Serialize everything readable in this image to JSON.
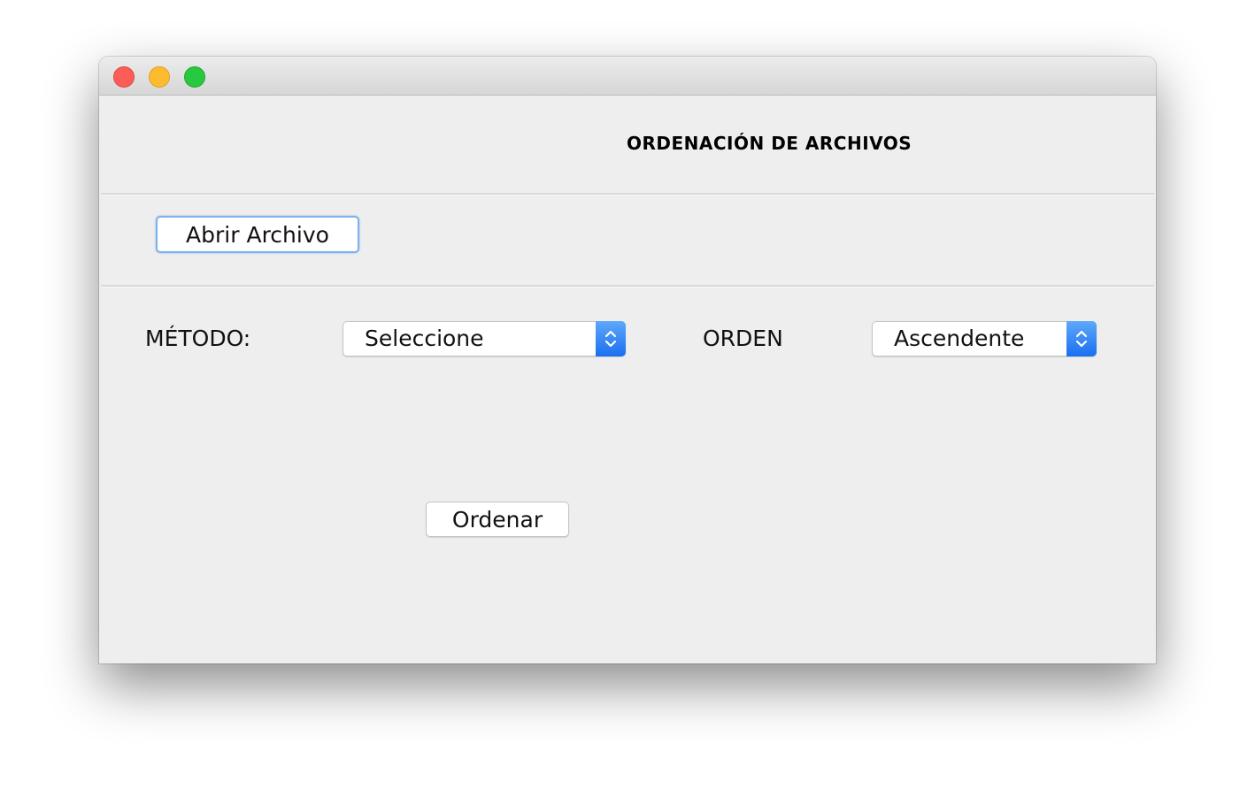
{
  "window": {
    "controls": [
      "close",
      "minimize",
      "zoom"
    ]
  },
  "header": {
    "title": "ORDENACIÓN DE ARCHIVOS"
  },
  "file": {
    "open_button": "Abrir Archivo"
  },
  "method": {
    "label": "MÉTODO:",
    "selected": "Seleccione"
  },
  "order": {
    "label": "ORDEN",
    "selected": "Ascendente"
  },
  "actions": {
    "sort_button": "Ordenar"
  },
  "colors": {
    "close": "#fd5d57",
    "minimize": "#fdbb2e",
    "zoom": "#28c840",
    "accent": "#1a6ff0",
    "background": "#eeeeee"
  }
}
